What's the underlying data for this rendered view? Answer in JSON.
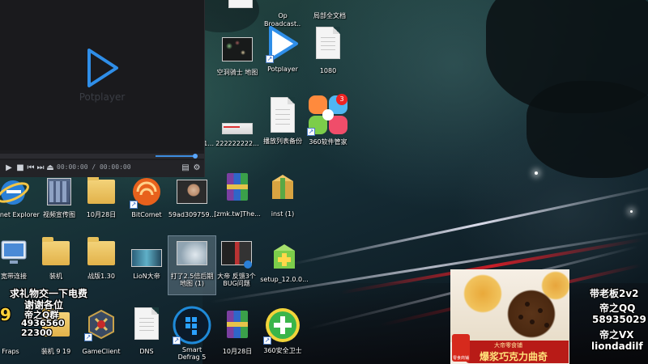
{
  "player": {
    "logo_text": "Potplayer",
    "time_display": "00:00:00 / 00:00:00",
    "accent": "#3d8de0"
  },
  "icons": [
    {
      "key": "top-1",
      "label": "",
      "kind": "doc"
    },
    {
      "key": "top-2",
      "label": "Op Broadcast...",
      "kind": "app"
    },
    {
      "key": "top-3",
      "label": "局部全文档",
      "kind": "doc"
    },
    {
      "key": "kongdong",
      "label": "空洞骑士 地图",
      "kind": "thumb"
    },
    {
      "key": "potplayer",
      "label": "Potplayer",
      "kind": "potplayer"
    },
    {
      "key": "1080",
      "label": "1080",
      "kind": "doc"
    },
    {
      "key": "partial-1",
      "label": "1...",
      "kind": "partial"
    },
    {
      "key": "2222",
      "label": "222222222...",
      "kind": "thumb"
    },
    {
      "key": "playlist",
      "label": "播放列表备份",
      "kind": "doc"
    },
    {
      "key": "360mgr",
      "label": "360软件管家",
      "kind": "360mgr",
      "badge": "3"
    },
    {
      "key": "ie",
      "label": "Internet Explorer",
      "kind": "ie"
    },
    {
      "key": "video",
      "label": "视频宣传图",
      "kind": "video"
    },
    {
      "key": "oct28a",
      "label": "10月28日",
      "kind": "folder"
    },
    {
      "key": "bitcomet",
      "label": "BitComet",
      "kind": "bitcomet"
    },
    {
      "key": "59ad",
      "label": "59ad309759...",
      "kind": "photo"
    },
    {
      "key": "zmk",
      "label": "[zmk.tw]The...",
      "kind": "rar"
    },
    {
      "key": "inst",
      "label": "inst (1)",
      "kind": "inst"
    },
    {
      "key": "broadband",
      "label": "宽带连接",
      "kind": "pc"
    },
    {
      "key": "zhuangji",
      "label": "装机",
      "kind": "folder"
    },
    {
      "key": "zhanban",
      "label": "战版1.30",
      "kind": "folder"
    },
    {
      "key": "lion",
      "label": "LioN大帝",
      "kind": "lion"
    },
    {
      "key": "map",
      "label": "打了2.5倍后期 地图 (1)",
      "kind": "map",
      "selected": true
    },
    {
      "key": "bug",
      "label": "大帝 反馈3个 BUG问题",
      "kind": "bug"
    },
    {
      "key": "setup",
      "label": "setup_12.0.0...",
      "kind": "setup"
    },
    {
      "key": "fraps",
      "label": "Fraps",
      "kind": "fraps"
    },
    {
      "key": "zhuangji919",
      "label": "装机 9 19",
      "kind": "folder"
    },
    {
      "key": "gameclient",
      "label": "GameClient",
      "kind": "game"
    },
    {
      "key": "dns",
      "label": "DNS",
      "kind": "doc"
    },
    {
      "key": "defrag",
      "label": "Smart Defrag 5",
      "kind": "defrag"
    },
    {
      "key": "oct28b",
      "label": "10月28日",
      "kind": "rar"
    },
    {
      "key": "360guard",
      "label": "360安全卫士",
      "kind": "360guard"
    }
  ],
  "overlay": {
    "gift_line1": "求礼物交一下电费",
    "gift_line2": "谢谢各位",
    "gift_line3": "帝之Q群",
    "gift_line4": "4936560",
    "gift_line5": "22300",
    "big_digit": "9",
    "right_line1": "带老板2v2",
    "right_line2": "帝之QQ",
    "right_line3": "58935029",
    "right_line4": "帝之VX",
    "right_line5": "liondadilf"
  },
  "ad": {
    "store": "大帝零食铺",
    "title": "爆浆巧克力曲奇",
    "logo_text": "零食商铺"
  }
}
